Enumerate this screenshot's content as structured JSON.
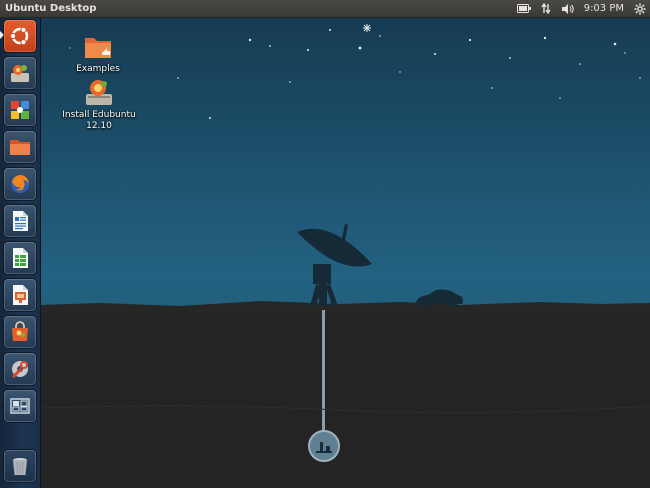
{
  "panel": {
    "title": "Ubuntu Desktop",
    "clock": "9:03 PM",
    "indicators": [
      "battery-icon",
      "network-transfer-icon",
      "volume-icon",
      "session-gear-icon"
    ]
  },
  "launcher": {
    "items": [
      {
        "name": "dash-home",
        "icon": "ubuntu-logo-icon"
      },
      {
        "name": "ubuntu-software-center",
        "icon": "software-center-icon"
      },
      {
        "name": "edubuntu-menu",
        "icon": "puzzle-icon"
      },
      {
        "name": "home-folder",
        "icon": "folder-icon"
      },
      {
        "name": "firefox",
        "icon": "firefox-icon"
      },
      {
        "name": "libreoffice-writer",
        "icon": "writer-icon"
      },
      {
        "name": "libreoffice-calc",
        "icon": "calc-icon"
      },
      {
        "name": "libreoffice-impress",
        "icon": "impress-icon"
      },
      {
        "name": "software-center-bag",
        "icon": "shopping-bag-icon"
      },
      {
        "name": "system-settings",
        "icon": "settings-wrench-icon"
      },
      {
        "name": "workspace-switcher",
        "icon": "workspaces-icon"
      },
      {
        "name": "trash",
        "icon": "trash-icon"
      }
    ]
  },
  "desktop": {
    "icons": [
      {
        "label": "Examples",
        "icon": "examples-folder-icon"
      },
      {
        "label_line1": "Install Edubuntu",
        "label_line2": "12.10",
        "icon": "installer-icon"
      }
    ]
  },
  "colors": {
    "sky_top": "#163b52",
    "sky_mid": "#236281",
    "ground": "#2b2b2b",
    "panel": "#3c3b37",
    "launcher": "#1c3550"
  }
}
